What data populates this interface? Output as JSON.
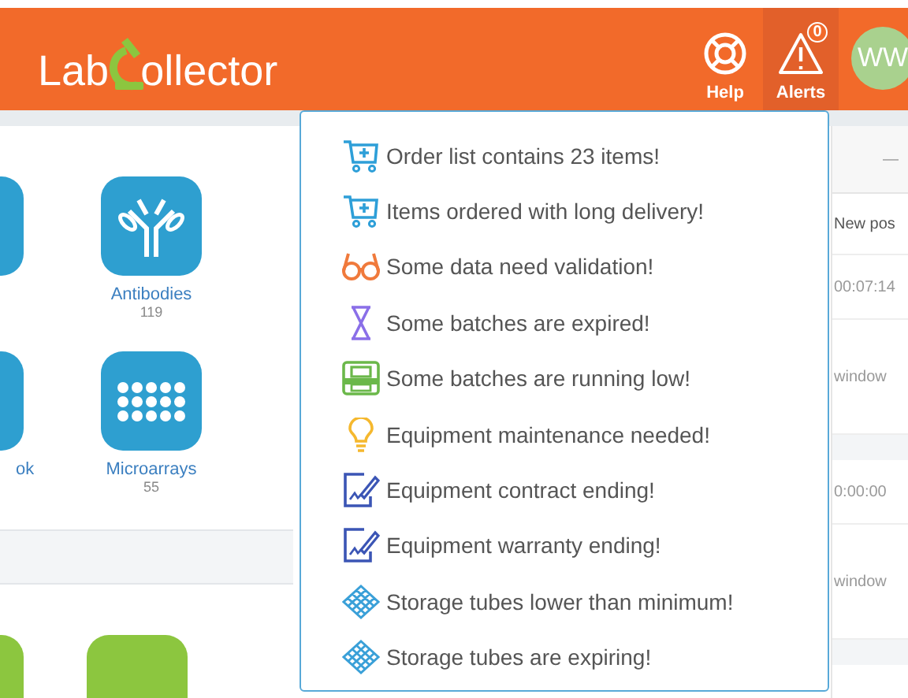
{
  "header": {
    "logo": {
      "before": "Lab",
      "after": "ollector"
    },
    "help": {
      "label": "Help"
    },
    "alerts": {
      "label": "Alerts",
      "count": "0",
      "selected": true
    },
    "avatar": {
      "initials": "WW"
    }
  },
  "tiles": [
    {
      "kind": "cut"
    },
    {
      "label": "Antibodies",
      "count": "119",
      "kind": "antibody"
    },
    {
      "label": "ok",
      "kind": "cut"
    },
    {
      "label": "Microarrays",
      "count": "55",
      "kind": "array"
    }
  ],
  "bottom_tiles": [
    {
      "kind": "cut"
    },
    {
      "kind": "full"
    }
  ],
  "right_panel": {
    "header": "—",
    "column": "New pos",
    "rows": [
      {
        "time": "00:07:14",
        "text": "window"
      },
      {
        "time": "0:00:00",
        "text": "window"
      }
    ]
  },
  "alerts_menu": [
    {
      "kind": "cart",
      "text": "Order list contains 23 items!"
    },
    {
      "kind": "cart",
      "text": "Items ordered with long delivery!"
    },
    {
      "kind": "glasses",
      "text": "Some data need validation!"
    },
    {
      "kind": "hourglass",
      "text": "Some batches are expired!"
    },
    {
      "kind": "tray",
      "text": "Some batches are running low!"
    },
    {
      "kind": "bulb",
      "text": "Equipment maintenance needed!"
    },
    {
      "kind": "contract",
      "text": "Equipment contract ending!"
    },
    {
      "kind": "contract",
      "text": "Equipment warranty ending!"
    },
    {
      "kind": "grid",
      "text": "Storage tubes lower than minimum!"
    },
    {
      "kind": "grid",
      "text": "Storage tubes are expiring!"
    }
  ]
}
